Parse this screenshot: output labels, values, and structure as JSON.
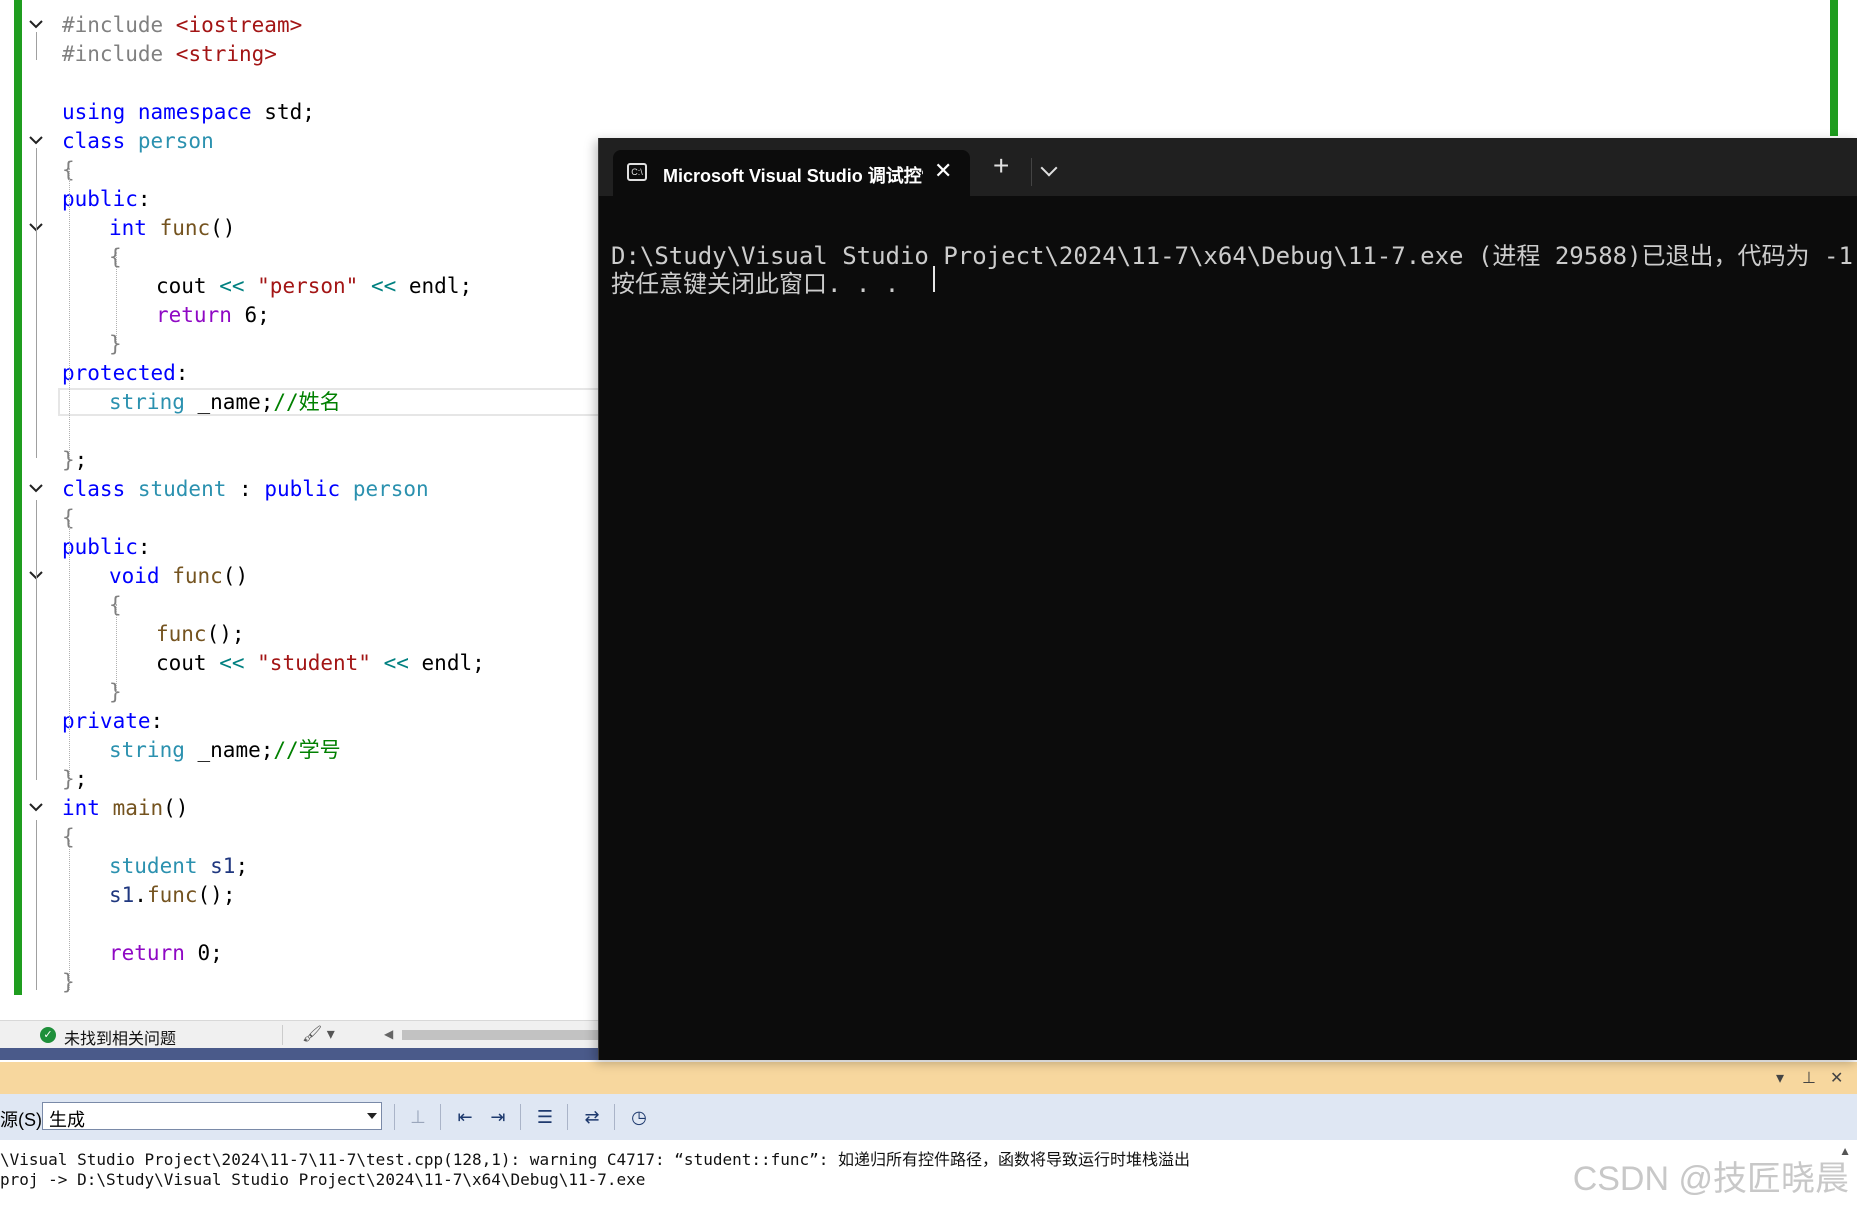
{
  "editor": {
    "lines": [
      {
        "fold": true,
        "indent": 0,
        "tokens": [
          [
            "pp",
            "#include "
          ],
          [
            "inc",
            "<iostream>"
          ]
        ]
      },
      {
        "fold": false,
        "indent": 0,
        "tokens": [
          [
            "pp",
            "#include "
          ],
          [
            "inc",
            "<string>"
          ]
        ]
      },
      {
        "fold": false,
        "indent": 0,
        "tokens": []
      },
      {
        "fold": false,
        "indent": 0,
        "tokens": [
          [
            "kw",
            "using "
          ],
          [
            "kw",
            "namespace "
          ],
          [
            "plain",
            "std;"
          ]
        ]
      },
      {
        "fold": true,
        "indent": 0,
        "tokens": [
          [
            "kw",
            "class "
          ],
          [
            "type",
            "person"
          ]
        ]
      },
      {
        "fold": false,
        "indent": 0,
        "tokens": [
          [
            "brace",
            "{"
          ]
        ]
      },
      {
        "fold": false,
        "indent": 0,
        "tokens": [
          [
            "kw",
            "public"
          ],
          [
            "plain",
            ":"
          ]
        ]
      },
      {
        "fold": true,
        "indent": 1,
        "tokens": [
          [
            "kw",
            "int "
          ],
          [
            "fn",
            "func"
          ],
          [
            "plain",
            "()"
          ]
        ]
      },
      {
        "fold": false,
        "indent": 1,
        "tokens": [
          [
            "brace",
            "{"
          ]
        ]
      },
      {
        "fold": false,
        "indent": 2,
        "tokens": [
          [
            "plain",
            "cout "
          ],
          [
            "op",
            "<< "
          ],
          [
            "str",
            "\"person\" "
          ],
          [
            "op",
            "<< "
          ],
          [
            "plain",
            "endl;"
          ]
        ]
      },
      {
        "fold": false,
        "indent": 2,
        "tokens": [
          [
            "kw2",
            "return "
          ],
          [
            "plain",
            "6;"
          ]
        ]
      },
      {
        "fold": false,
        "indent": 1,
        "tokens": [
          [
            "brace",
            "}"
          ]
        ]
      },
      {
        "fold": false,
        "indent": 0,
        "tokens": [
          [
            "kw",
            "protected"
          ],
          [
            "plain",
            ":"
          ]
        ]
      },
      {
        "fold": false,
        "indent": 1,
        "tokens": [
          [
            "type",
            "string "
          ],
          [
            "plain",
            "_name;"
          ],
          [
            "cmt",
            "//姓名"
          ]
        ]
      },
      {
        "fold": false,
        "indent": 0,
        "tokens": []
      },
      {
        "fold": false,
        "indent": 0,
        "tokens": [
          [
            "brace",
            "}"
          ],
          [
            "plain",
            ";"
          ]
        ]
      },
      {
        "fold": true,
        "indent": 0,
        "tokens": [
          [
            "kw",
            "class "
          ],
          [
            "type",
            "student "
          ],
          [
            "plain",
            ": "
          ],
          [
            "kw",
            "public "
          ],
          [
            "type",
            "person"
          ]
        ]
      },
      {
        "fold": false,
        "indent": 0,
        "tokens": [
          [
            "brace",
            "{"
          ]
        ]
      },
      {
        "fold": false,
        "indent": 0,
        "tokens": [
          [
            "kw",
            "public"
          ],
          [
            "plain",
            ":"
          ]
        ]
      },
      {
        "fold": true,
        "indent": 1,
        "tokens": [
          [
            "kw",
            "void "
          ],
          [
            "fn",
            "func"
          ],
          [
            "plain",
            "()"
          ]
        ]
      },
      {
        "fold": false,
        "indent": 1,
        "tokens": [
          [
            "brace",
            "{"
          ]
        ]
      },
      {
        "fold": false,
        "indent": 2,
        "tokens": [
          [
            "fn",
            "func"
          ],
          [
            "plain",
            "();"
          ]
        ]
      },
      {
        "fold": false,
        "indent": 2,
        "tokens": [
          [
            "plain",
            "cout "
          ],
          [
            "op",
            "<< "
          ],
          [
            "str",
            "\"student\" "
          ],
          [
            "op",
            "<< "
          ],
          [
            "plain",
            "endl;"
          ]
        ]
      },
      {
        "fold": false,
        "indent": 1,
        "tokens": [
          [
            "brace",
            "}"
          ]
        ]
      },
      {
        "fold": false,
        "indent": 0,
        "tokens": [
          [
            "kw",
            "private"
          ],
          [
            "plain",
            ":"
          ]
        ]
      },
      {
        "fold": false,
        "indent": 1,
        "tokens": [
          [
            "type",
            "string "
          ],
          [
            "plain",
            "_name;"
          ],
          [
            "cmt",
            "//学号"
          ]
        ]
      },
      {
        "fold": false,
        "indent": 0,
        "tokens": [
          [
            "brace",
            "}"
          ],
          [
            "plain",
            ";"
          ]
        ]
      },
      {
        "fold": true,
        "indent": 0,
        "tokens": [
          [
            "kw",
            "int "
          ],
          [
            "fn",
            "main"
          ],
          [
            "plain",
            "()"
          ]
        ]
      },
      {
        "fold": false,
        "indent": 0,
        "tokens": [
          [
            "brace",
            "{"
          ]
        ]
      },
      {
        "fold": false,
        "indent": 1,
        "tokens": [
          [
            "type",
            "student "
          ],
          [
            "var",
            "s1"
          ],
          [
            "plain",
            ";"
          ]
        ]
      },
      {
        "fold": false,
        "indent": 1,
        "tokens": [
          [
            "var",
            "s1"
          ],
          [
            "plain",
            "."
          ],
          [
            "fn",
            "func"
          ],
          [
            "plain",
            "();"
          ]
        ]
      },
      {
        "fold": false,
        "indent": 0,
        "tokens": []
      },
      {
        "fold": false,
        "indent": 1,
        "tokens": [
          [
            "kw2",
            "return "
          ],
          [
            "plain",
            "0;"
          ]
        ]
      },
      {
        "fold": false,
        "indent": 0,
        "tokens": [
          [
            "brace",
            "}"
          ]
        ]
      }
    ]
  },
  "editor_status": {
    "issues_text": "未找到相关问题"
  },
  "terminal": {
    "tab_title": "Microsoft Visual Studio 调试控制台",
    "lines": [
      "D:\\Study\\Visual Studio Project\\2024\\11-7\\x64\\Debug\\11-7.exe (进程 29588)已退出，代码为 -1",
      "按任意键关闭此窗口. . ."
    ]
  },
  "output": {
    "source_label": "源(S):",
    "source_value": "生成",
    "lines": [
      "\\Visual Studio Project\\2024\\11-7\\11-7\\test.cpp(128,1): warning C4717: “student::func”: 如递归所有控件路径，函数将导致运行时堆栈溢出",
      "proj -> D:\\Study\\Visual Studio Project\\2024\\11-7\\x64\\Debug\\11-7.exe"
    ]
  },
  "watermark": "CSDN @技匠晓晨"
}
